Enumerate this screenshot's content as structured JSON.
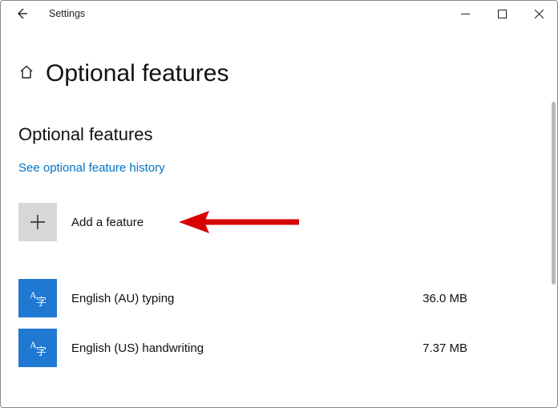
{
  "window": {
    "app_name": "Settings"
  },
  "page": {
    "title": "Optional features",
    "section_title": "Optional features",
    "history_link": "See optional feature history",
    "add_label": "Add a feature"
  },
  "features": [
    {
      "name": "English (AU) typing",
      "size": "36.0 MB"
    },
    {
      "name": "English (US) handwriting",
      "size": "7.37 MB"
    }
  ],
  "annotation": {
    "arrow_color": "#d60000"
  }
}
